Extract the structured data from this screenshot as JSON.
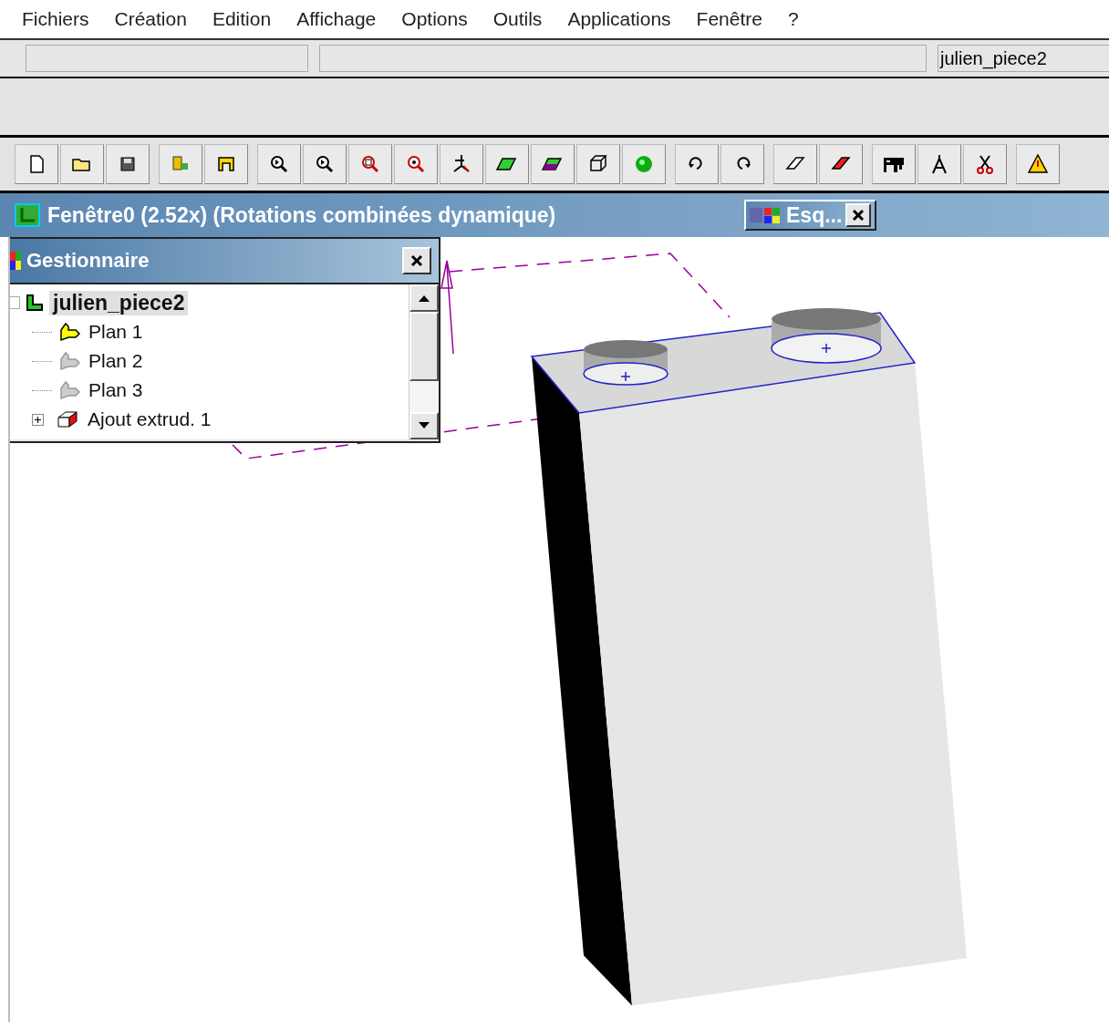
{
  "menu": [
    "Fichiers",
    "Création",
    "Edition",
    "Affichage",
    "Options",
    "Outils",
    "Applications",
    "Fenêtre",
    "?"
  ],
  "status_field": {
    "value": "julien_piece2"
  },
  "window": {
    "title": "Fenêtre0 (2.52x) (Rotations combinées dynamique)"
  },
  "minimized_window": {
    "title": "Esq..."
  },
  "manager": {
    "title": "Gestionnaire",
    "tree": [
      {
        "label": "julien_piece2",
        "selected": true,
        "expanded": true,
        "kind": "part",
        "children": [
          {
            "label": "Plan 1",
            "kind": "plane",
            "active": true,
            "selected": false
          },
          {
            "label": "Plan 2",
            "kind": "plane",
            "active": false,
            "selected": false
          },
          {
            "label": "Plan 3",
            "kind": "plane",
            "active": false,
            "selected": false
          },
          {
            "label": "Ajout extrud. 1",
            "kind": "extrusion",
            "expanded": false,
            "selected": false
          }
        ]
      }
    ]
  }
}
